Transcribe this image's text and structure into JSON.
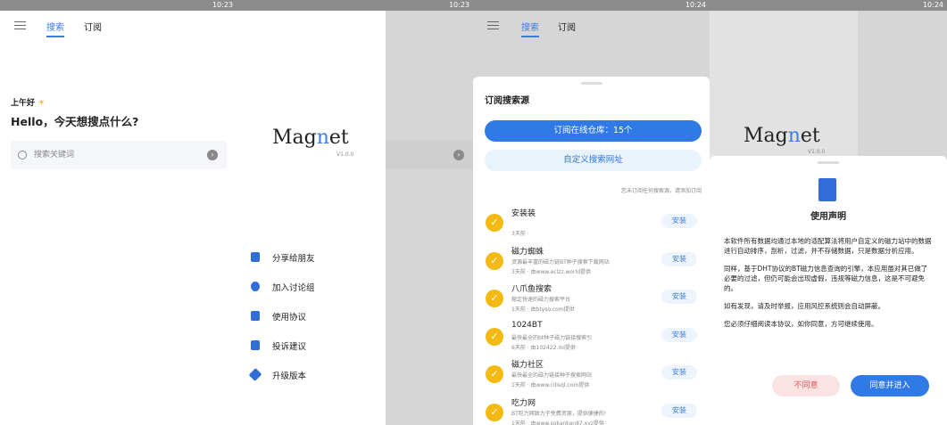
{
  "status": {
    "time1": "10:23",
    "time2": "10:23",
    "time3": "10:24",
    "time4": "10:24"
  },
  "tabs": {
    "search": "搜索",
    "subscribe": "订阅"
  },
  "home": {
    "greeting": "上午好",
    "hello": "Hello，今天想搜点什么?",
    "search_placeholder": "搜索关键词"
  },
  "logo": {
    "text_a": "Mag",
    "text_n": "n",
    "text_b": "et",
    "version": "V1.0.0"
  },
  "drawer": {
    "items": [
      {
        "label": "分享给朋友",
        "icon": "share-icon"
      },
      {
        "label": "加入讨论组",
        "icon": "chat-icon"
      },
      {
        "label": "使用协议",
        "icon": "document-icon"
      },
      {
        "label": "投诉建议",
        "icon": "feedback-icon"
      },
      {
        "label": "升级版本",
        "icon": "rocket-icon"
      }
    ]
  },
  "subscribe_sheet": {
    "title": "订阅搜索源",
    "online_button": "订阅在线仓库：15个",
    "custom_button": "自定义搜索网址",
    "hint": "您未订阅任何搜索源，请添加订阅",
    "install_label": "安装",
    "sources": [
      {
        "name": "安装装",
        "desc": "",
        "meta": "3天前 ·"
      },
      {
        "name": "磁力蜘蛛",
        "desc": "资源最丰富的磁力链BT种子搜索下载网站",
        "meta": "3天前 · 由www.eclzz.world提供"
      },
      {
        "name": "八爪鱼搜索",
        "desc": "稳定快速的磁力搜索平台",
        "meta": "1天前 · 由btyso.com提供"
      },
      {
        "name": "1024BT",
        "desc": "最快最全的bt种子磁力链接搜索引",
        "meta": "6天前 · 由102422.ml提供"
      },
      {
        "name": "磁力社区",
        "desc": "最快最全的磁力链接种子搜索网站",
        "meta": "1天前 · 由www.cilisql.com提供"
      },
      {
        "name": "吃力网",
        "desc": "BT吃力网致力于免费资源，提供便捷的!",
        "meta": "1天前 · 由www.sokankan87.xyz提供"
      }
    ]
  },
  "agreement": {
    "title": "使用声明",
    "paragraphs": [
      "本软件所有数据均通过本地的适配算法将用户自定义的磁力站中的数据进行自动排序，剖析，过滤，并不存储数据，只是数据分析应用。",
      "同样，基于DHT协议的BT磁力信息查询的引擎，本应用虽对其已做了必要的过滤，但仍可能会出现虚假，违规等磁力信息，这是不可避免的。",
      "如有发现，请及时举报，应用风控系统则会自动屏蔽。",
      "您必须仔细阅读本协议，如你同意，方可继续使用。"
    ],
    "disagree": "不同意",
    "agree": "同意并进入"
  },
  "colors": {
    "accent": "#2f7ae5",
    "badge": "#f5b914",
    "disagree": "#e05a5a"
  }
}
